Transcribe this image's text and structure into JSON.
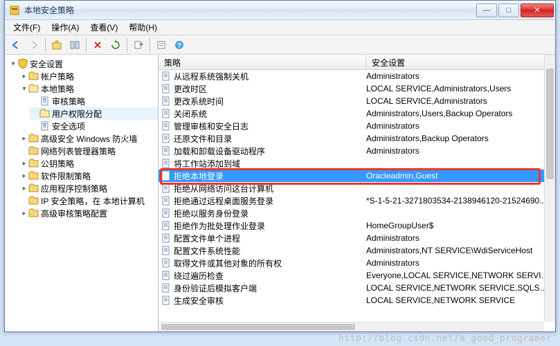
{
  "window": {
    "title": "本地安全策略"
  },
  "menu": {
    "file": "文件(F)",
    "action": "操作(A)",
    "view": "查看(V)",
    "help": "帮助(H)"
  },
  "toolbar_icons": [
    "back",
    "forward",
    "up",
    "show-hide",
    "delete",
    "refresh",
    "export",
    "properties",
    "help"
  ],
  "tree": {
    "root": "安全设置",
    "items": [
      {
        "label": "帐户策略",
        "expanded": false,
        "children": []
      },
      {
        "label": "本地策略",
        "expanded": true,
        "children": [
          {
            "label": "审核策略"
          },
          {
            "label": "用户权限分配",
            "selected": true
          },
          {
            "label": "安全选项"
          }
        ]
      },
      {
        "label": "高级安全 Windows 防火墙",
        "expanded": false
      },
      {
        "label": "网络列表管理器策略"
      },
      {
        "label": "公钥策略",
        "expanded": false
      },
      {
        "label": "软件限制策略",
        "expanded": false
      },
      {
        "label": "应用程序控制策略",
        "expanded": false
      },
      {
        "label": "IP 安全策略，在 本地计算机"
      },
      {
        "label": "高级审核策略配置",
        "expanded": false
      }
    ]
  },
  "columns": {
    "policy": "策略",
    "setting": "安全设置"
  },
  "rows": [
    {
      "policy": "从远程系统强制关机",
      "setting": "Administrators"
    },
    {
      "policy": "更改时区",
      "setting": "LOCAL SERVICE,Administrators,Users"
    },
    {
      "policy": "更改系统时间",
      "setting": "LOCAL SERVICE,Administrators"
    },
    {
      "policy": "关闭系统",
      "setting": "Administrators,Users,Backup Operators"
    },
    {
      "policy": "管理审核和安全日志",
      "setting": "Administrators"
    },
    {
      "policy": "还原文件和目录",
      "setting": "Administrators,Backup Operators"
    },
    {
      "policy": "加载和卸载设备驱动程序",
      "setting": "Administrators"
    },
    {
      "policy": "将工作站添加到域",
      "setting": ""
    },
    {
      "policy": "拒绝本地登录",
      "setting": "Oracleadmin,Guest",
      "selected": true
    },
    {
      "policy": "拒绝从网络访问这台计算机",
      "setting": ""
    },
    {
      "policy": "拒绝通过远程桌面服务登录",
      "setting": "*S-1-5-21-3271803534-2138946120-21524690..."
    },
    {
      "policy": "拒绝以服务身份登录",
      "setting": ""
    },
    {
      "policy": "拒绝作为批处理作业登录",
      "setting": "HomeGroupUser$"
    },
    {
      "policy": "配置文件单个进程",
      "setting": "Administrators"
    },
    {
      "policy": "配置文件系统性能",
      "setting": "Administrators,NT SERVICE\\WdiServiceHost"
    },
    {
      "policy": "取得文件或其他对象的所有权",
      "setting": "Administrators"
    },
    {
      "policy": "绕过遍历检查",
      "setting": "Everyone,LOCAL SERVICE,NETWORK SERVICE,..."
    },
    {
      "policy": "身份验证后模拟客户端",
      "setting": "LOCAL SERVICE,NETWORK SERVICE,SQLServe..."
    },
    {
      "policy": "生成安全审核",
      "setting": "LOCAL SERVICE,NETWORK SERVICE"
    }
  ],
  "watermark": "http://blog.csdn.net/a_good_programer"
}
